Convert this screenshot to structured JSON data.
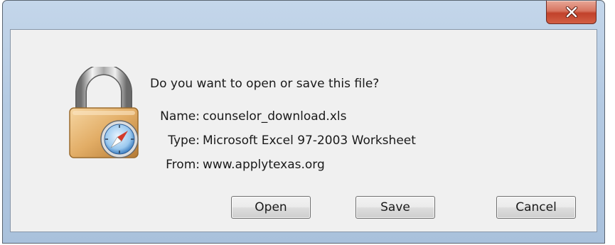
{
  "dialog": {
    "question": "Do you want to open or save this file?",
    "fields": [
      {
        "label": "Name:",
        "value": "counselor_download.xls"
      },
      {
        "label": "Type:",
        "value": "Microsoft Excel 97-2003 Worksheet"
      },
      {
        "label": "From:",
        "value": "www.applytexas.org"
      }
    ],
    "buttons": {
      "open": "Open",
      "save": "Save",
      "cancel": "Cancel"
    },
    "icons": {
      "close": "close-icon",
      "file": "lock-icon",
      "browser": "compass-icon"
    }
  }
}
